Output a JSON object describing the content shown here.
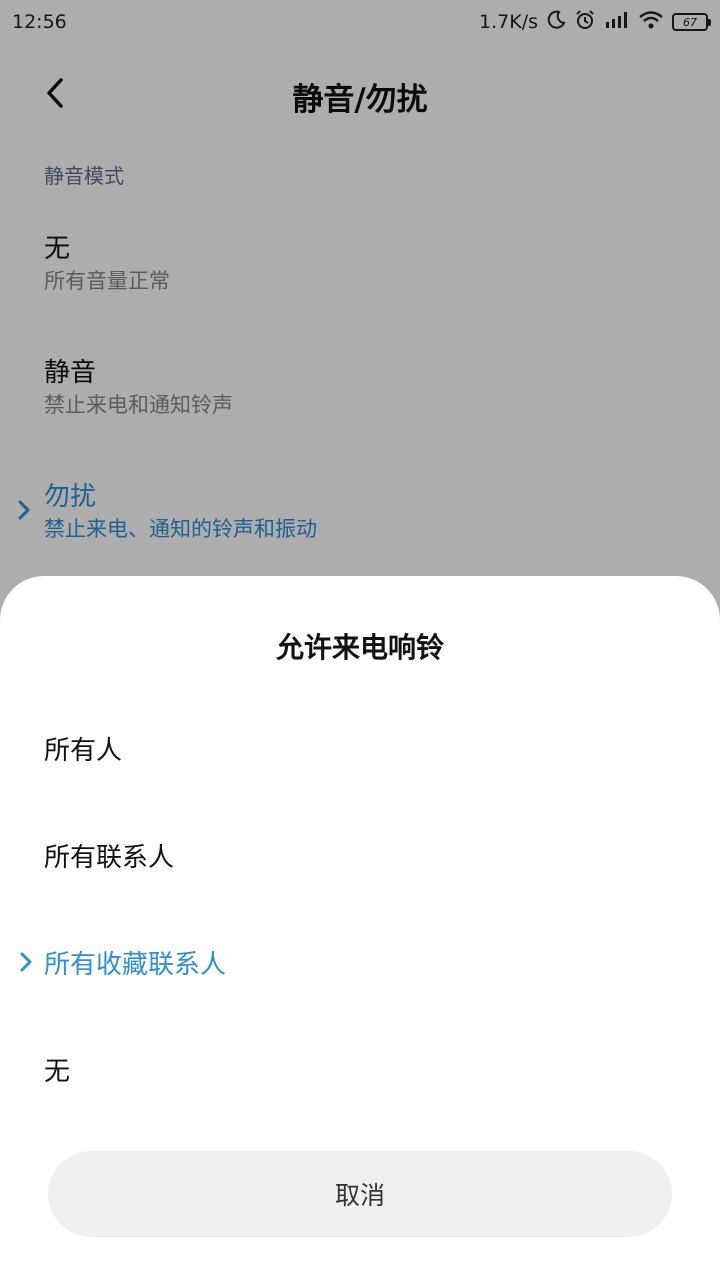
{
  "status_bar": {
    "time": "12:56",
    "network_speed": "1.7K/s",
    "battery_level": "67",
    "icons": [
      "moon-icon",
      "alarm-icon",
      "hd-signal-icon",
      "wifi-icon",
      "battery-icon"
    ]
  },
  "header": {
    "title": "静音/勿扰",
    "back_icon": "chevron-left-icon"
  },
  "silent_mode": {
    "section_label": "静音模式",
    "items": [
      {
        "title": "无",
        "subtitle": "所有音量正常",
        "selected": false
      },
      {
        "title": "静音",
        "subtitle": "禁止来电和通知铃声",
        "selected": false
      },
      {
        "title": "勿扰",
        "subtitle": "禁止来电、通知的铃声和振动",
        "selected": true
      }
    ]
  },
  "sheet": {
    "title": "允许来电响铃",
    "options": [
      {
        "label": "所有人",
        "selected": false
      },
      {
        "label": "所有联系人",
        "selected": false
      },
      {
        "label": "所有收藏联系人",
        "selected": true
      },
      {
        "label": "无",
        "selected": false
      }
    ],
    "cancel_label": "取消"
  },
  "colors": {
    "accent": "#2e8fd6",
    "section_header": "#5f6f8c",
    "subtitle": "#888888",
    "cancel_bg": "#f0f0f0"
  }
}
